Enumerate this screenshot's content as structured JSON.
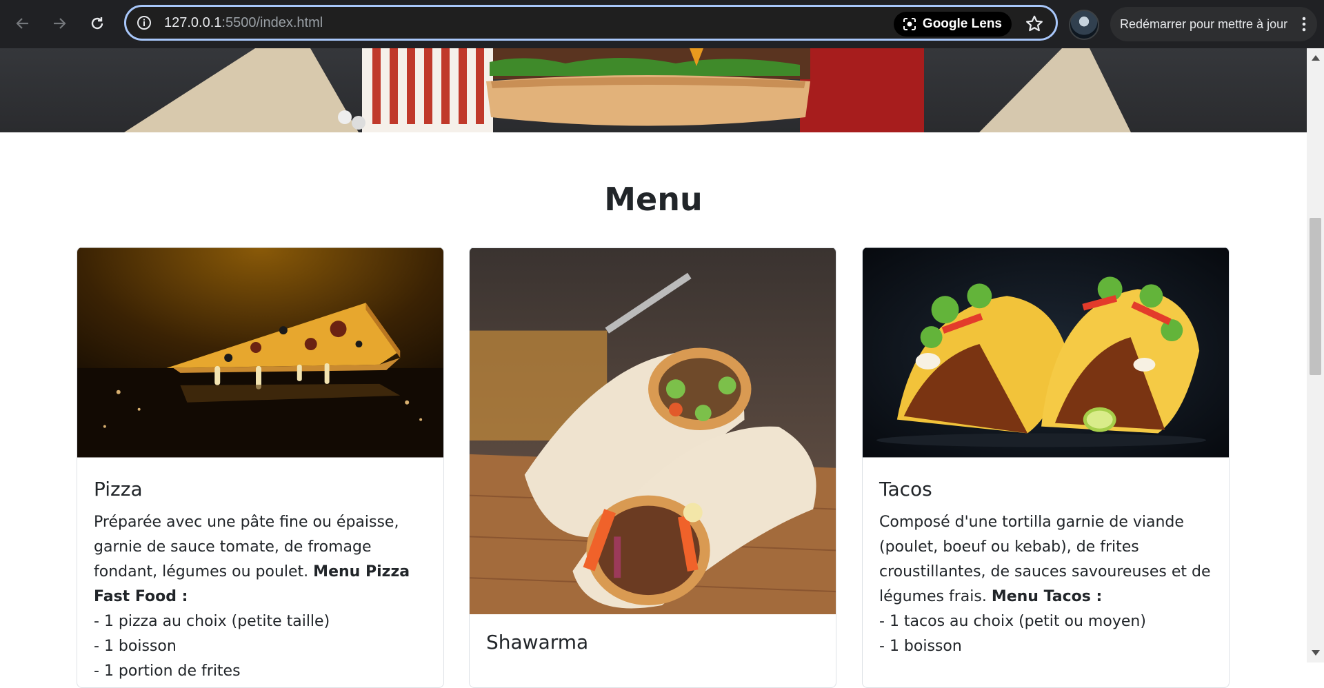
{
  "browser": {
    "url_host": "127.0.0.1",
    "url_path": ":5500/index.html",
    "lens_label": "Google Lens",
    "update_label": "Redémarrer pour mettre à jour"
  },
  "menu": {
    "title": "Menu",
    "cards": [
      {
        "title": "Pizza",
        "text": "Préparée avec une pâte fine ou épaisse, garnie de sauce tomate, de fromage fondant, légumes ou poulet.",
        "menu_label": "Menu Pizza Fast Food :",
        "items": [
          "1 pizza au choix (petite taille)",
          "1 boisson",
          "1 portion de frites"
        ]
      },
      {
        "title": "Shawarma"
      },
      {
        "title": "Tacos",
        "text": "Composé d'une tortilla garnie de viande (poulet, boeuf ou kebab), de frites croustillantes, de sauces savoureuses et de légumes frais.",
        "menu_label": "Menu Tacos :",
        "items": [
          "1 tacos au choix (petit ou moyen)",
          "1 boisson"
        ]
      }
    ]
  },
  "colors": {
    "chrome_bg": "#202124",
    "omnibox_focus": "#a8c7fa",
    "text_dark": "#212529",
    "card_border": "#dee2e6"
  },
  "icons": [
    "back-arrow-icon",
    "forward-arrow-icon",
    "reload-icon",
    "info-icon",
    "lens-icon",
    "star-icon",
    "kebab-menu-icon"
  ]
}
